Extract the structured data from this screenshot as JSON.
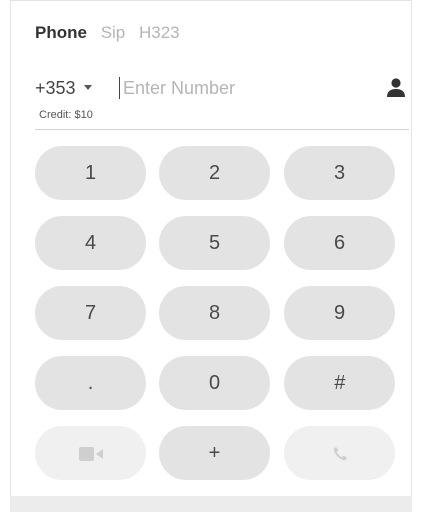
{
  "tabs": [
    {
      "label": "Phone",
      "active": true
    },
    {
      "label": "Sip",
      "active": false
    },
    {
      "label": "H323",
      "active": false
    }
  ],
  "dialer": {
    "country_code": "+353",
    "number_value": "",
    "number_placeholder": "Enter Number",
    "contact_icon": "person-icon",
    "credit": "Credit: $10"
  },
  "keypad": {
    "rows": [
      [
        "1",
        "2",
        "3"
      ],
      [
        "4",
        "5",
        "6"
      ],
      [
        "7",
        "8",
        "9"
      ],
      [
        ".",
        "0",
        "#"
      ]
    ],
    "bottom": {
      "video_icon": "video-camera-icon",
      "plus_label": "+",
      "call_icon": "phone-icon"
    }
  },
  "colors": {
    "key_background": "#e3e3e3",
    "key_background_disabled": "#f0f0f0",
    "text_primary": "#333333",
    "text_muted": "#b5b5b5"
  }
}
